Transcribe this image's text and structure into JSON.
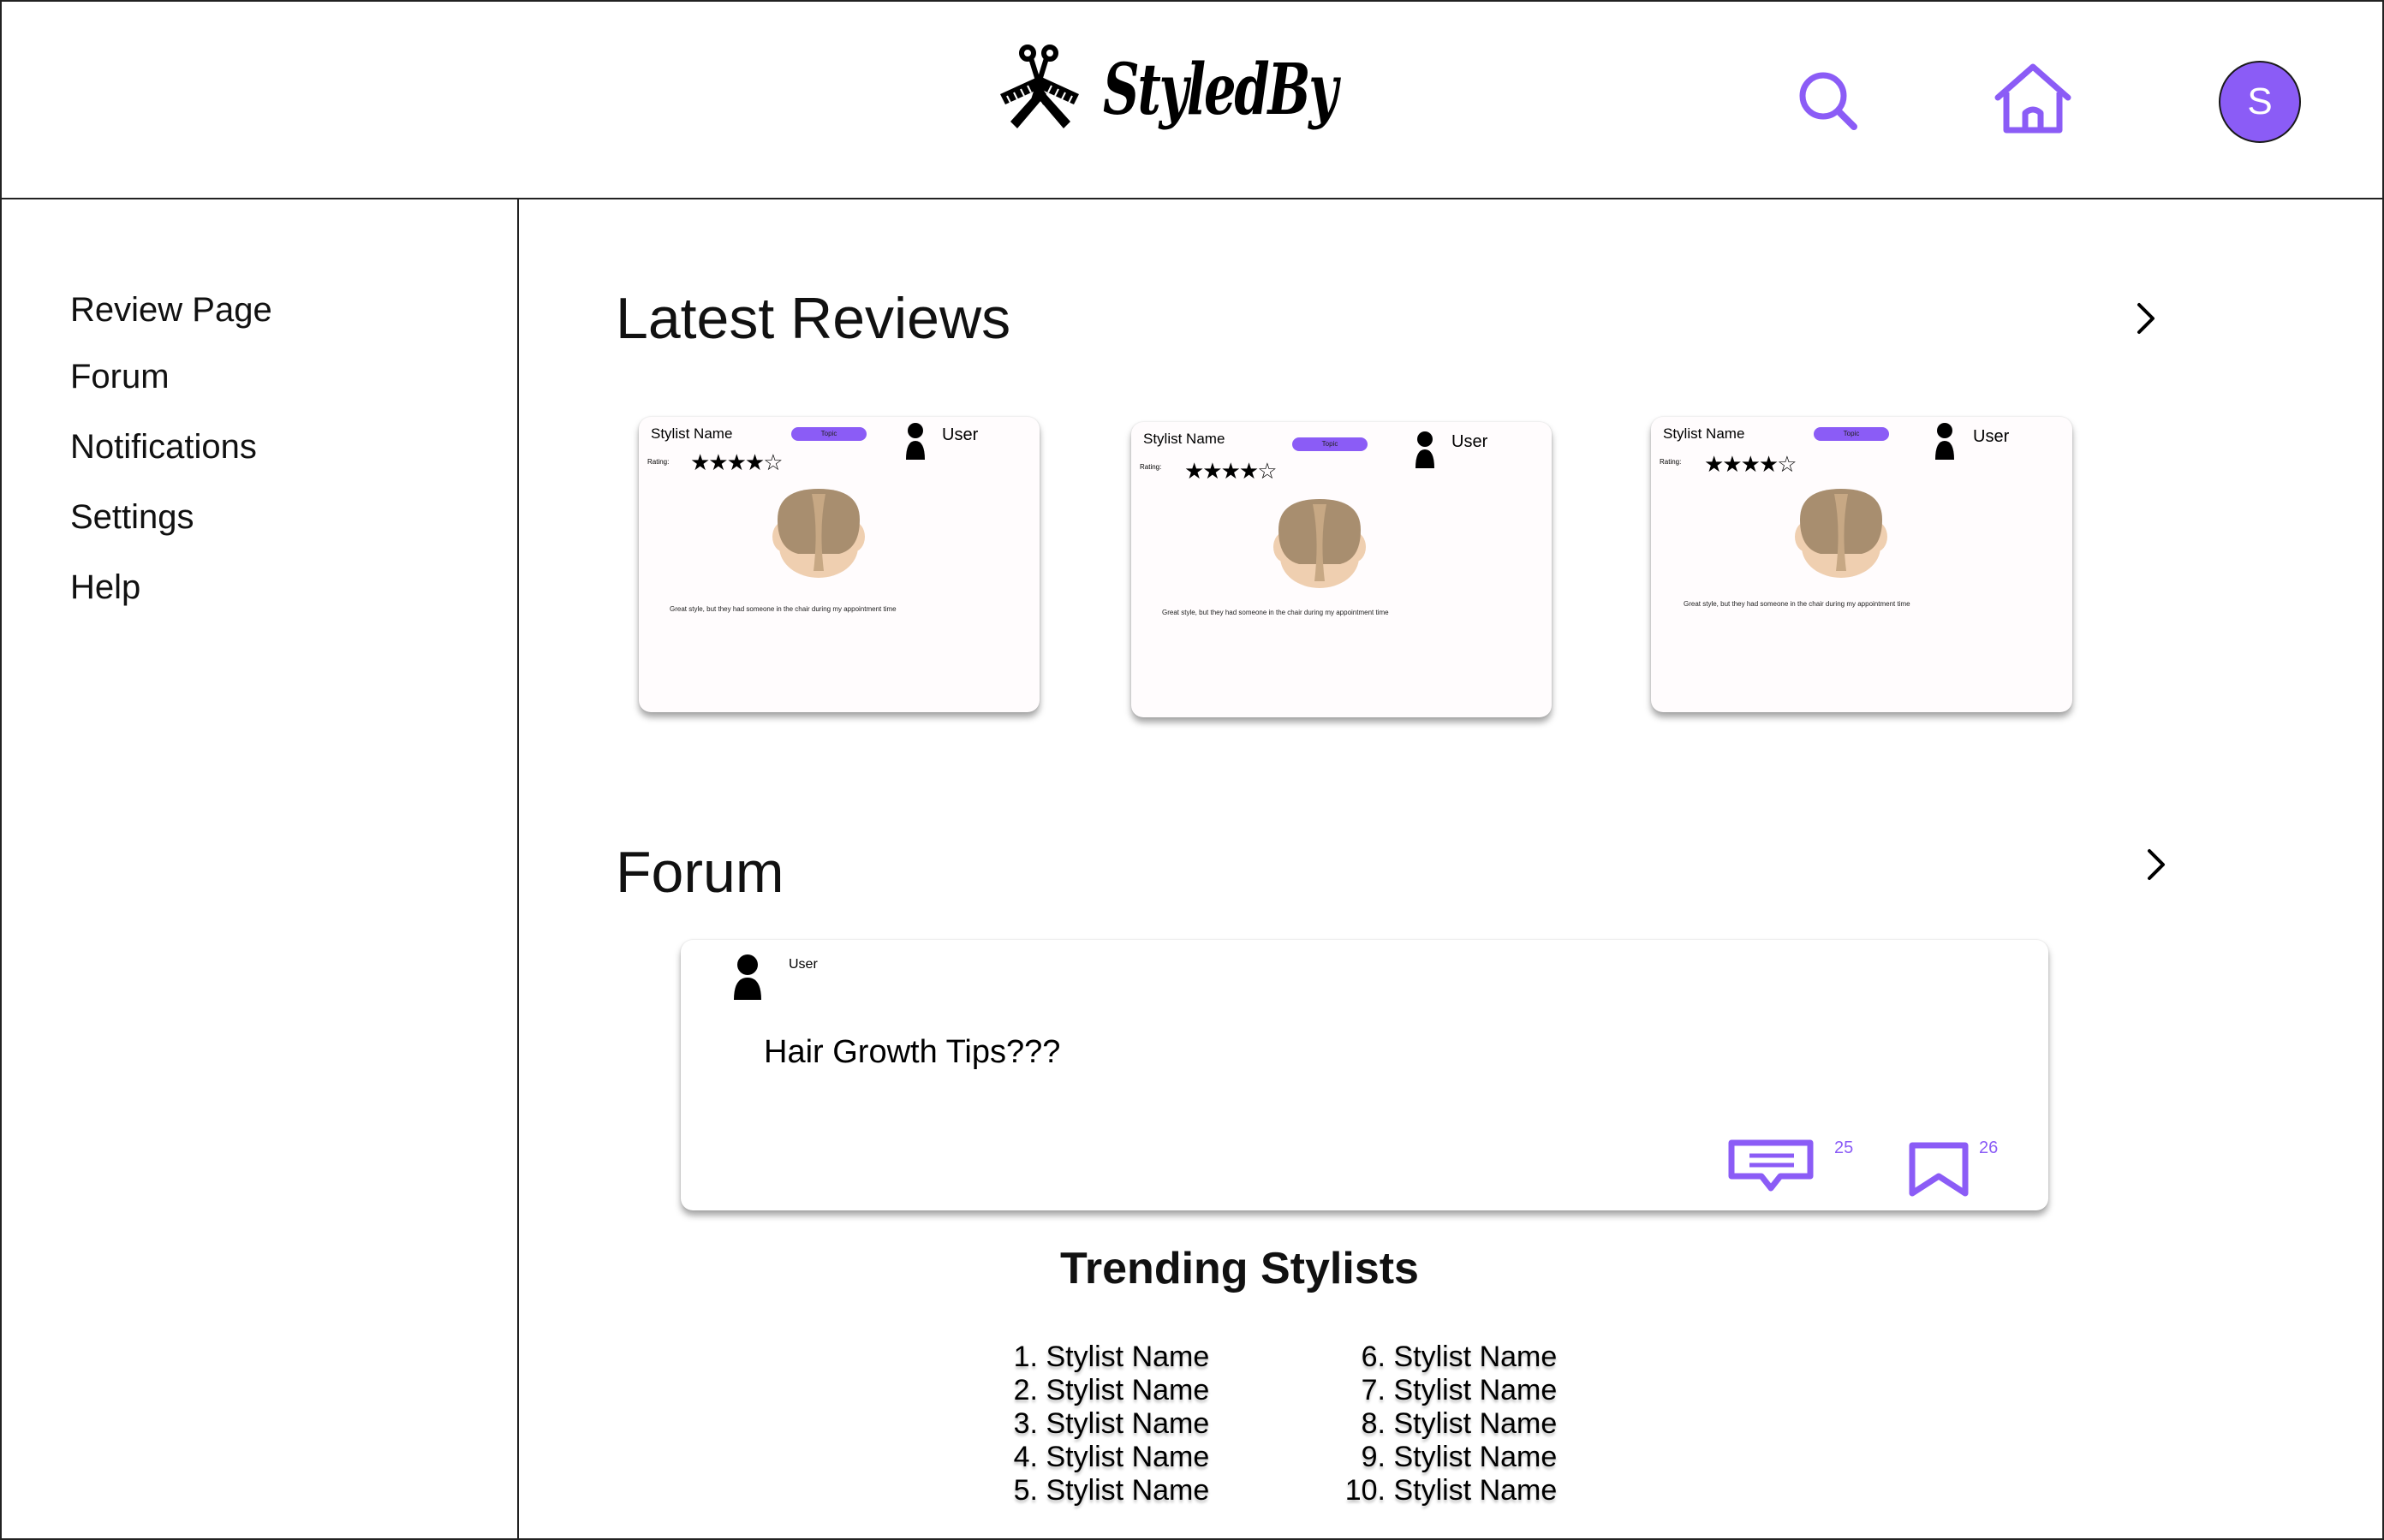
{
  "app": {
    "brand": "StyledBy",
    "avatar_initial": "S",
    "accent_color": "#8b5cf6"
  },
  "header": {
    "icons": [
      "search-icon",
      "home-icon"
    ]
  },
  "sidebar": {
    "items": [
      {
        "label": "Review Page"
      },
      {
        "label": "Forum"
      },
      {
        "label": "Notifications"
      },
      {
        "label": "Settings"
      },
      {
        "label": "Help"
      }
    ]
  },
  "reviews": {
    "title": "Latest Reviews",
    "cards": [
      {
        "stylist": "Stylist Name",
        "topic": "Topic",
        "user": "User",
        "rating_label": "Rating:",
        "stars": "★★★★☆",
        "text": "Great style, but they had someone in the chair during my appointment time"
      },
      {
        "stylist": "Stylist Name",
        "topic": "Topic",
        "user": "User",
        "rating_label": "Rating:",
        "stars": "★★★★☆",
        "text": "Great style, but they had someone in the chair during my appointment time"
      },
      {
        "stylist": "Stylist Name",
        "topic": "Topic",
        "user": "User",
        "rating_label": "Rating:",
        "stars": "★★★★☆",
        "text": "Great style, but they had someone in the chair during my appointment time"
      }
    ]
  },
  "forum": {
    "title": "Forum",
    "post": {
      "user": "User",
      "title": "Hair Growth Tips???",
      "comments": "25",
      "saves": "26"
    }
  },
  "trending": {
    "title": "Trending Stylists",
    "left": [
      {
        "num": "1.",
        "name": "Stylist Name"
      },
      {
        "num": "2.",
        "name": "Stylist Name"
      },
      {
        "num": "3.",
        "name": "Stylist Name"
      },
      {
        "num": "4.",
        "name": "Stylist Name"
      },
      {
        "num": "5.",
        "name": "Stylist Name"
      }
    ],
    "right": [
      {
        "num": "6.",
        "name": "Stylist Name"
      },
      {
        "num": "7.",
        "name": "Stylist Name"
      },
      {
        "num": "8.",
        "name": "Stylist Name"
      },
      {
        "num": "9.",
        "name": "Stylist Name"
      },
      {
        "num": "10.",
        "name": "Stylist Name"
      }
    ]
  }
}
